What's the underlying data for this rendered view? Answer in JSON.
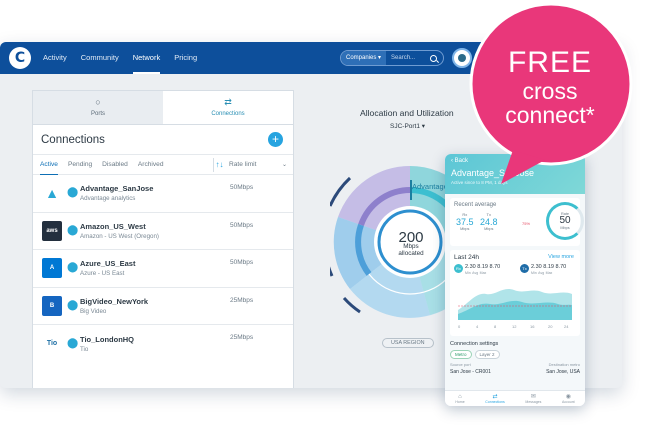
{
  "nav": {
    "logo": "C",
    "links": [
      "Activity",
      "Community",
      "Network",
      "Pricing"
    ],
    "active_link": "Network",
    "search_scope": "Companies",
    "search_placeholder": "Search..."
  },
  "panel": {
    "tabs": [
      {
        "label": "Ports",
        "icon": "port-icon"
      },
      {
        "label": "Connections",
        "icon": "connections-icon"
      }
    ],
    "title": "Connections",
    "add": "+",
    "filters": [
      "Active",
      "Pending",
      "Disabled",
      "Archived"
    ],
    "active_filter": "Active",
    "sort_icon": "↑↓",
    "rate_header": "Rate limit",
    "rows": [
      {
        "name": "Advantage_SanJose",
        "company": "Advantage analytics",
        "rate": "50Mbps",
        "logo": "advantage-logo",
        "logo_text": "A"
      },
      {
        "name": "Amazon_US_West",
        "company": "Amazon - US West (Oregon)",
        "rate": "50Mbps",
        "logo": "aws-logo",
        "logo_text": "aws"
      },
      {
        "name": "Azure_US_East",
        "company": "Azure - US East",
        "rate": "50Mbps",
        "logo": "azure-logo",
        "logo_text": "A"
      },
      {
        "name": "BigVideo_NewYork",
        "company": "Big Video",
        "rate": "25Mbps",
        "logo": "bigvideo-logo",
        "logo_text": "B"
      },
      {
        "name": "Tio_LondonHQ",
        "company": "Tio",
        "rate": "25Mbps",
        "logo": "tio-logo",
        "logo_text": "Tio"
      }
    ]
  },
  "center": {
    "title": "Allocation and Utilization",
    "port": "SJC-Port1",
    "allocated_value": "200",
    "allocated_unit": "Mbps",
    "allocated_label": "allocated",
    "hover_label": "Advantage_SanJose",
    "region_badge": "USA REGION"
  },
  "phone": {
    "back": "Back",
    "name": "Advantage_SanJose",
    "subtitle": "Active since to 8 PM, 1 days",
    "recent_title": "Recent average",
    "rx_label": "Rx",
    "rx_value": "37.5",
    "rx_unit": "Mbps",
    "tx_label": "Tx",
    "tx_value": "24.8",
    "tx_unit": "Mbps",
    "pct": "75%",
    "ring_label": "Rate",
    "ring_value": "50",
    "ring_unit": "Mbps",
    "last24_title": "Last 24h",
    "view_more": "View more",
    "rx_stats": [
      "2.30",
      "8.19",
      "8.70"
    ],
    "tx_stats": [
      "2.30",
      "8.19",
      "8.70"
    ],
    "stat_labels": [
      "Min",
      "Avg",
      "Max"
    ],
    "x_ticks": [
      "0",
      "4",
      "8",
      "12",
      "16",
      "20",
      "24"
    ],
    "settings_title": "Connection settings",
    "chips": [
      "Metro",
      "Layer 2"
    ],
    "src_label": "Source port",
    "dst_label": "Destination metro",
    "src_value": "San Jose - CR001",
    "dst_value": "San Jose, USA",
    "bar": [
      "Home",
      "Connections",
      "Messages",
      "Account"
    ]
  },
  "promo": {
    "line1": "FREE",
    "line2": "cross",
    "line3": "connect*",
    "color": "#e9377a"
  },
  "colors": {
    "nav": "#0d4f9b",
    "accent": "#27a4e0",
    "teal": "#3dbfcf"
  }
}
